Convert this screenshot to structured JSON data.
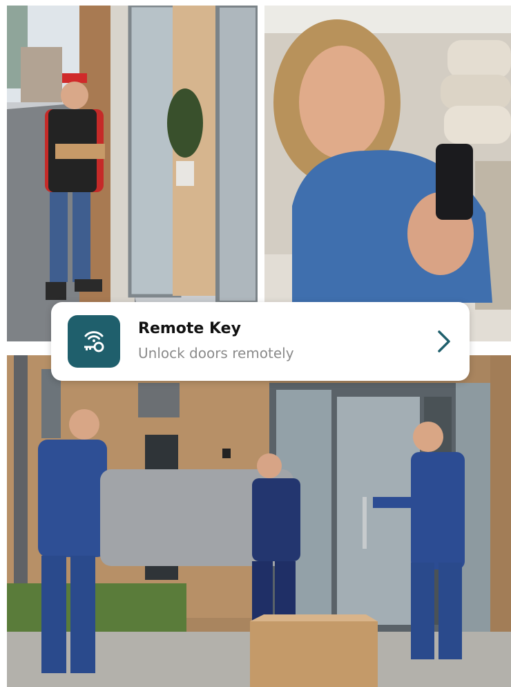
{
  "card": {
    "title": "Remote Key",
    "subtitle": "Unlock doors remotely",
    "icon": "wifi-key-icon",
    "action_icon": "chevron-right-icon",
    "accent_color": "#1f5f6c"
  },
  "photos": [
    {
      "name": "courier-at-door-photo"
    },
    {
      "name": "woman-with-phone-photo"
    },
    {
      "name": "movers-with-sofa-photo"
    }
  ]
}
